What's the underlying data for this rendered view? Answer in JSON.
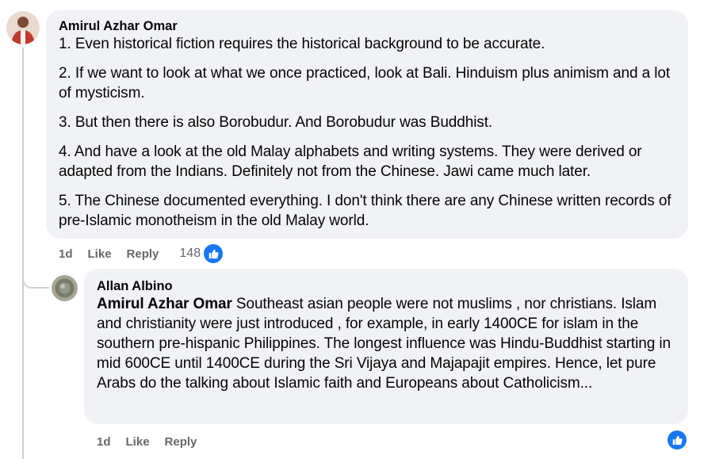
{
  "comments": [
    {
      "author": "Amirul Azhar Omar",
      "paragraphs": [
        "1. Even historical fiction requires the historical background to be accurate.",
        "2. If we want to look at what we once practiced, look at Bali. Hinduism plus animism and a lot of mysticism.",
        "3. But then there is also Borobudur. And Borobudur was Buddhist.",
        "4. And have a look at the old Malay alphabets and writing systems. They were derived or adapted from the Indians. Definitely not from the Chinese. Jawi came much later.",
        "5. The Chinese documented everything. I don't think there are any Chinese written records of pre-Islamic monotheism in the old Malay world."
      ],
      "age": "1d",
      "like_label": "Like",
      "reply_label": "Reply",
      "reaction_count": "148",
      "reaction_icon": "thumbs-up-icon"
    },
    {
      "author": "Allan Albino",
      "mention": "Amirul Azhar Omar",
      "text": " Southeast asian people were not muslims , nor christians. Islam and christianity were just introduced , for example, in early 1400CE for islam in the southern pre-hispanic Philippines. The longest influence was Hindu-Buddhist starting in mid 600CE until 1400CE during the Sri Vijaya and Majapajit empires. Hence, let pure Arabs do the talking about Islamic faith and Europeans about Catholicism...",
      "age": "1d",
      "like_label": "Like",
      "reply_label": "Reply",
      "reaction_icon": "thumbs-up-icon"
    }
  ],
  "colors": {
    "bubble": "#f0f2f5",
    "meta_text": "#65676b",
    "like_blue": "#1877f2",
    "thread_line": "#ced0d4"
  }
}
